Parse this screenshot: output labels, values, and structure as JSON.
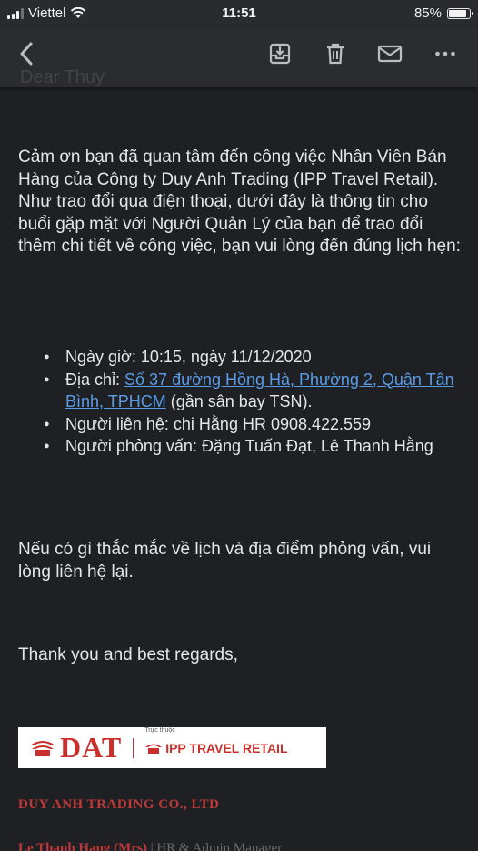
{
  "status_bar": {
    "carrier": "Viettel",
    "time": "11:51",
    "battery": "85%",
    "battery_level": 0.85
  },
  "toolbar": {
    "faded_header": "Dear Thuy",
    "icons": [
      "back-icon",
      "archive-icon",
      "trash-icon",
      "mail-icon",
      "more-icon"
    ]
  },
  "email": {
    "intro": "Cảm ơn bạn đã quan tâm đến công việc Nhân Viên Bán Hàng của Công ty Duy Anh Trading (IPP Travel Retail). Như trao đổi qua điện thoại, dưới đây là thông tin cho buổi gặp mặt với Người Quản Lý của bạn để trao đổi thêm chi tiết về công việc, bạn vui lòng đến đúng lịch hẹn:",
    "details": {
      "datetime": "Ngày giờ: 10:15, ngày 11/12/2020",
      "address_label": "Địa chỉ: ",
      "address_link": "Số 37 đường Hồng Hà, Phường 2, Quận Tân Bình, TPHCM",
      "address_note": " (gần sân bay TSN).",
      "contact": "Người liên hệ: chi Hằng HR 0908.422.559",
      "interviewers": "Người phỏng vấn: Đặng Tuấn Đạt, Lê Thanh Hằng"
    },
    "closing_question": "Nếu có gì thắc mắc về lịch và địa điểm phỏng vấn, vui lòng liên hệ lại.",
    "sign_off": "Thank you and best regards,"
  },
  "signature": {
    "logo_dat": "DAT",
    "logo_truc_thuoc": "Trực thuộc",
    "logo_ipp": "IPP TRAVEL RETAIL",
    "company": "DUY ANH TRADING CO., LTD",
    "name": "Le Thanh Hang (Mrs)",
    "role": " | HR & Admin Manager"
  },
  "colors": {
    "background": "#1f2024",
    "link": "#5b9ce8",
    "brand_red": "#c9302c"
  }
}
